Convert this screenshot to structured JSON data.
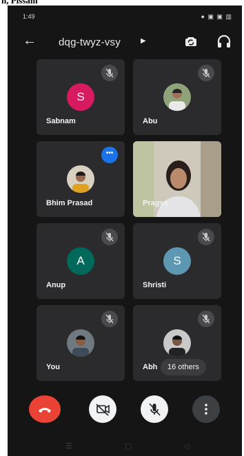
{
  "caption": "n, Pissam",
  "status": {
    "time": "1:49",
    "right": "● ▣ ▣ ▥"
  },
  "meeting": {
    "code": "dqg-twyz-vsy"
  },
  "participants": [
    {
      "name": "Sabnam",
      "initial": "S",
      "color": "#d81b60"
    },
    {
      "name": "Abu"
    },
    {
      "name": "Bhim Prasad"
    },
    {
      "name": "Pragya"
    },
    {
      "name": "Anup",
      "initial": "A",
      "color": "#00695c"
    },
    {
      "name": "Shristi",
      "initial": "S",
      "color": "#5e97b2"
    },
    {
      "name": "You"
    },
    {
      "name": "Abh"
    }
  ],
  "others": {
    "label": "16 others"
  },
  "icons": {
    "back": "arrow-left-icon",
    "caret": "caret-right-icon",
    "flip": "camera-flip-icon",
    "audio": "headphones-icon",
    "mute": "mic-off-icon",
    "more": "more-horizontal-icon",
    "end": "phone-hangup-icon",
    "camera": "camera-off-icon",
    "mic": "mic-off-icon",
    "options": "more-vertical-icon"
  },
  "colors": {
    "end_call": "#ea4335",
    "control": "#f1f3f4",
    "more_bg": "#3c4043"
  }
}
